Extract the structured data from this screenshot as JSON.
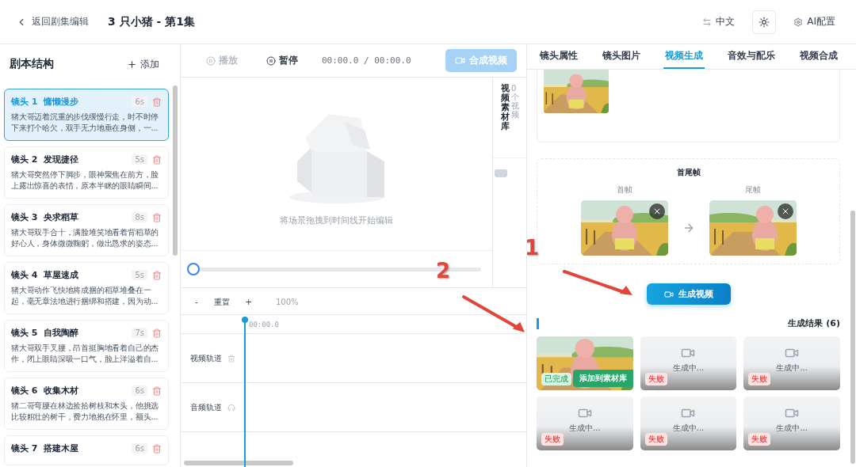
{
  "header": {
    "back": "返回剧集编辑",
    "title": "3 只小猪 - 第1集",
    "language": "中文",
    "ai_config": "AI配置"
  },
  "sidebar": {
    "title": "剧本结构",
    "add": "添加",
    "shots": [
      {
        "number": "镜头 1",
        "title": "慵懒漫步",
        "duration": "6s",
        "description": "猪大哥迈着沉重的步伐缓慢行走，时不时停下来打个哈欠，双手无力地垂在身侧，一...",
        "selected": true
      },
      {
        "number": "镜头 2",
        "title": "发现捷径",
        "duration": "5s",
        "description": "猪大哥突然停下脚步，眼神聚焦在前方，脸上露出惊喜的表情，原本半眯的眼睛瞬间...",
        "selected": false
      },
      {
        "number": "镜头 3",
        "title": "央求稻草",
        "duration": "8s",
        "description": "猪大哥双手合十，满脸堆笑地看着背稻草的好心人，身体微微鞠躬，做出恳求的姿态...",
        "selected": false
      },
      {
        "number": "镜头 4",
        "title": "草屋速成",
        "duration": "5s",
        "description": "猪大哥动作飞快地将成捆的稻草堆叠在一起，毫无章法地进行捆绑和搭建，因为动...",
        "selected": false
      },
      {
        "number": "镜头 5",
        "title": "自我陶醉",
        "duration": "7s",
        "description": "猪大哥双手叉腰，昂首挺胸地看着自己的杰作，闭上眼睛深吸一口气，脸上洋溢着自...",
        "selected": false
      },
      {
        "number": "镜头 6",
        "title": "收集木材",
        "duration": "6s",
        "description": "猪二哥弯腰在林边捡拾树枝和木头，他挑选比较粗壮的树干，费力地抱在怀里，额头...",
        "selected": false
      },
      {
        "number": "镜头 7",
        "title": "搭建木屋",
        "duration": "6s",
        "selected": false
      }
    ]
  },
  "editor": {
    "play": {
      "label": "播放",
      "disabled": true
    },
    "pause": {
      "label": "暂停",
      "disabled": false
    },
    "time": "00:00.0 / 00:00.0",
    "compose": {
      "label": "合成视频",
      "disabled": true
    },
    "empty_hint": "将场景拖拽到时间线开始编辑",
    "library": {
      "title": "视频素材库",
      "count": "0个视频"
    },
    "scrub": {
      "level": 0
    },
    "zoom": {
      "minus": "-",
      "reset": "重置",
      "plus": "+",
      "percent": "100%"
    },
    "ruler": "00:00.0",
    "tracks": [
      {
        "kind": "video",
        "label": "视频轨道"
      },
      {
        "kind": "audio",
        "label": "音频轨道"
      }
    ]
  },
  "panel": {
    "tabs": [
      {
        "label": "镜头属性",
        "selected": false
      },
      {
        "label": "镜头图片",
        "selected": false
      },
      {
        "label": "视频生成",
        "selected": true
      },
      {
        "label": "音效与配乐",
        "selected": false
      },
      {
        "label": "视频合成",
        "selected": false
      }
    ],
    "frames": {
      "title": "首尾帧",
      "first": "首帧",
      "last": "尾帧"
    },
    "generate": "生成视频",
    "results_title": "生成结果 (6)",
    "results": [
      {
        "kind": "done",
        "status": "已完成",
        "action": "添加到素材库"
      },
      {
        "kind": "failed",
        "status": "失败",
        "caption": "生成中..."
      },
      {
        "kind": "failed",
        "status": "失败",
        "caption": "生成中..."
      },
      {
        "kind": "failed",
        "status": "失败",
        "caption": "生成中..."
      },
      {
        "kind": "failed",
        "status": "失败",
        "caption": "生成中..."
      },
      {
        "kind": "failed",
        "status": "失败",
        "caption": "生成中..."
      }
    ]
  },
  "annotations": [
    {
      "label": "1"
    },
    {
      "label": "2"
    }
  ]
}
